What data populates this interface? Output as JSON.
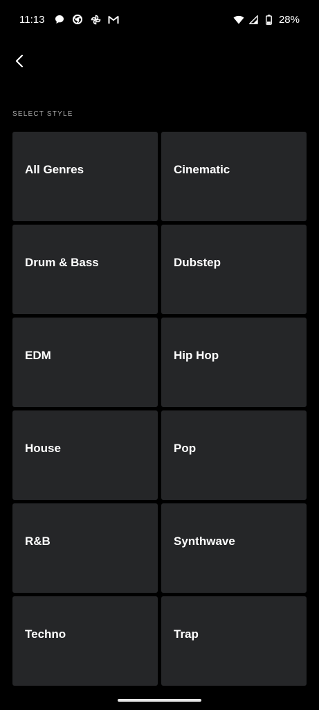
{
  "status_bar": {
    "time": "11:13",
    "battery": "28%",
    "notification_icons": [
      "chat-icon",
      "chrome-icon",
      "pinwheel-icon",
      "gmail-icon"
    ]
  },
  "header": {
    "back_icon": "chevron-left-icon"
  },
  "section_label": "SELECT STYLE",
  "genres": [
    "All Genres",
    "Cinematic",
    "Drum & Bass",
    "Dubstep",
    "EDM",
    "Hip Hop",
    "House",
    "Pop",
    "R&B",
    "Synthwave",
    "Techno",
    "Trap"
  ],
  "colors": {
    "background": "#000000",
    "tile": "#252628",
    "label_muted": "#a8a8a8"
  }
}
